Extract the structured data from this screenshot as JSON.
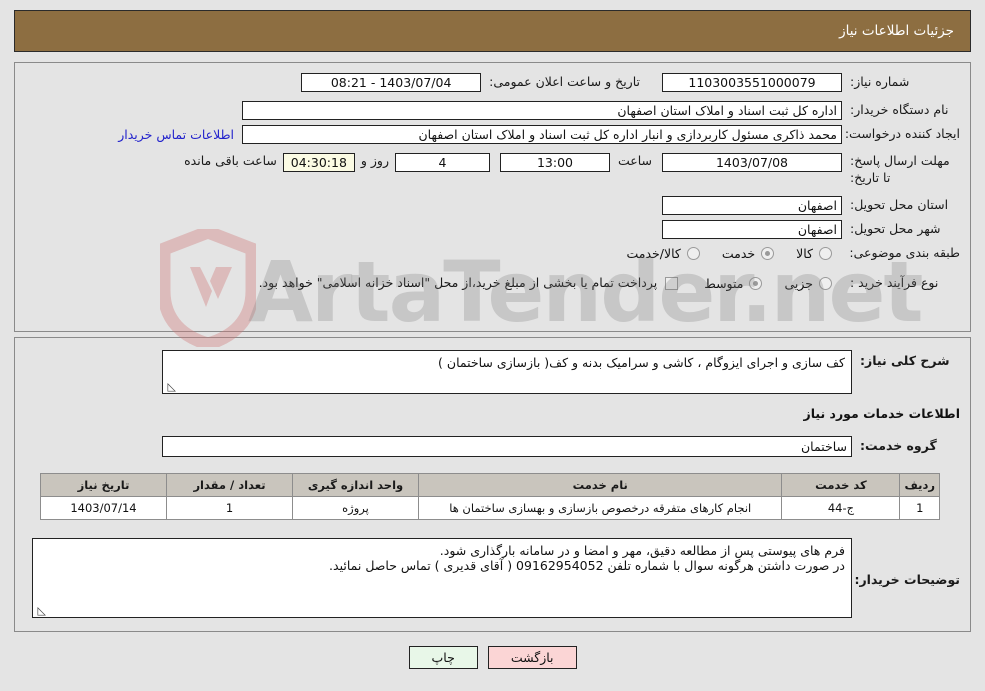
{
  "header": {
    "title": "جزئیات اطلاعات نیاز"
  },
  "form": {
    "need_number": {
      "label": "شماره نیاز:",
      "value": "1103003551000079"
    },
    "announce_datetime": {
      "label": "تاریخ و ساعت اعلان عمومی:",
      "value": "1403/07/04 - 08:21"
    },
    "buyer_org": {
      "label": "نام دستگاه خریدار:",
      "value": "اداره کل ثبت اسناد و املاک استان اصفهان"
    },
    "request_creator": {
      "label": "ایجاد کننده درخواست:",
      "value": "محمد ذاکری مسئول کاربردازی و انبار اداره کل ثبت اسناد و املاک استان اصفهان",
      "contact_link": "اطلاعات تماس خریدار"
    },
    "deadline": {
      "label": "مهلت ارسال پاسخ: تا تاریخ:",
      "date": "1403/07/08",
      "hour_label": "ساعت",
      "hour": "13:00",
      "days": "4",
      "days_label": "روز و",
      "countdown": "04:30:18",
      "remaining_label": "ساعت باقی مانده"
    },
    "delivery_province": {
      "label": "استان محل تحویل:",
      "value": "اصفهان"
    },
    "delivery_city": {
      "label": "شهر محل تحویل:",
      "value": "اصفهان"
    },
    "category": {
      "label": "طبقه بندی موضوعی:",
      "options": [
        {
          "label": "کالا",
          "selected": false
        },
        {
          "label": "خدمت",
          "selected": true
        },
        {
          "label": "کالا/خدمت",
          "selected": false
        }
      ]
    },
    "purchase_type": {
      "label": "نوع فرآیند خرید :",
      "options": [
        {
          "label": "جزیی",
          "selected": false
        },
        {
          "label": "متوسط",
          "selected": true
        }
      ],
      "treasury_checkbox_checked": false,
      "treasury_note": "پرداخت تمام یا بخشی از مبلغ خرید،از محل \"اسناد خزانه اسلامی\" خواهد بود."
    },
    "general_description": {
      "label": "شرح کلی نیاز:",
      "value": "کف سازی و اجرای ایزوگام ، کاشی و سرامیک بدنه و کف( بازسازی ساختمان )"
    },
    "services_section_title": "اطلاعات خدمات مورد نیاز",
    "service_group": {
      "label": "گروه خدمت:",
      "value": "ساختمان"
    },
    "buyer_notes": {
      "label": "توضیحات خریدار:",
      "line1": "فرم های پیوستی پس از مطالعه دقیق، مهر و امضا و در سامانه بارگذاری شود.",
      "line2": "در صورت داشتن هرگونه سوال با شماره تلفن 09162954052 ( آقای قدیری ) تماس حاصل نمائید."
    }
  },
  "table": {
    "headers": [
      "ردیف",
      "کد خدمت",
      "نام خدمت",
      "واحد اندازه گیری",
      "تعداد / مقدار",
      "تاریخ نیاز"
    ],
    "rows": [
      {
        "index": "1",
        "service_code": "ج-44",
        "service_name": "انجام کارهای متفرقه درخصوص بازسازی و بهسازی ساختمان ها",
        "unit": "پروژه",
        "quantity": "1",
        "need_date": "1403/07/14"
      }
    ]
  },
  "buttons": {
    "print": "چاپ",
    "back": "بازگشت"
  },
  "watermark": {
    "text": "ArtaTender.net"
  },
  "colors": {
    "header_brown": "#8d6e41",
    "table_header": "#c9c5bd",
    "page_bg": "#e4e4e4",
    "link_blue": "#2222cc",
    "print_button": "#e8f7e8",
    "back_button": "#fbd5d5",
    "countdown_bg": "#fbfbe4"
  }
}
